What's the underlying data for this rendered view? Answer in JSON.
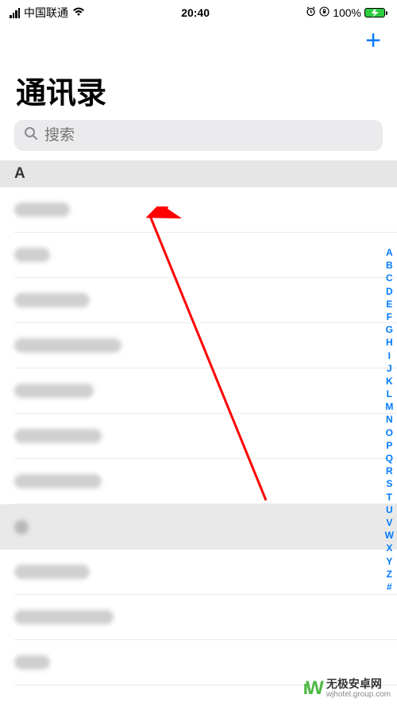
{
  "statusBar": {
    "carrier": "中国联通",
    "time": "20:40",
    "battery": "100%"
  },
  "title": "通讯录",
  "search": {
    "placeholder": "搜索"
  },
  "sections": [
    {
      "letter": "A"
    }
  ],
  "indexLetters": [
    "A",
    "B",
    "C",
    "D",
    "E",
    "F",
    "G",
    "H",
    "I",
    "J",
    "K",
    "L",
    "M",
    "N",
    "O",
    "P",
    "Q",
    "R",
    "S",
    "T",
    "U",
    "V",
    "W",
    "X",
    "Y",
    "Z",
    "#"
  ],
  "watermark": {
    "name": "无极安卓网",
    "url": "wjhotel.group.com"
  }
}
